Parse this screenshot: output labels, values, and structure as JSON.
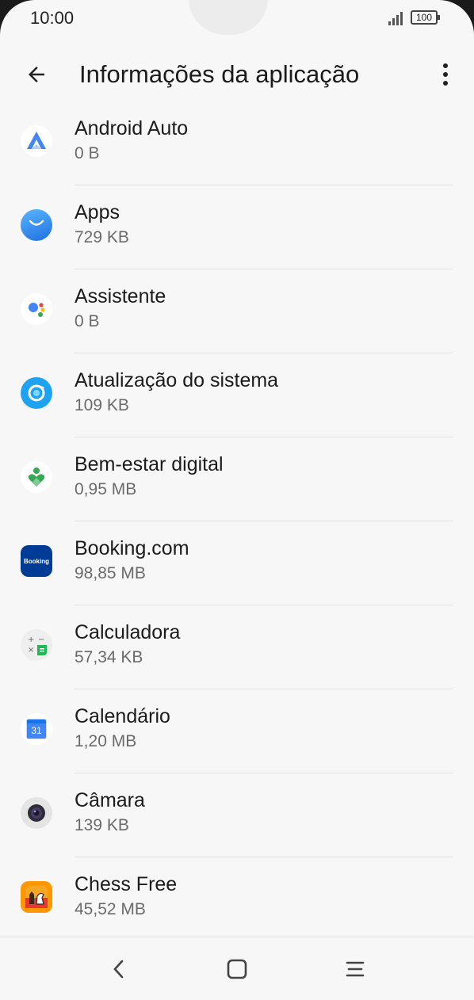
{
  "status_bar": {
    "time": "10:00",
    "battery": "100"
  },
  "app_bar": {
    "title": "Informações da aplicação"
  },
  "apps": [
    {
      "name": "Android Auto",
      "size": "0 B",
      "icon": "android-auto-icon"
    },
    {
      "name": "Apps",
      "size": "729 KB",
      "icon": "apps-store-icon"
    },
    {
      "name": "Assistente",
      "size": "0 B",
      "icon": "assistant-icon"
    },
    {
      "name": "Atualização do sistema",
      "size": "109 KB",
      "icon": "system-update-icon"
    },
    {
      "name": "Bem-estar digital",
      "size": "0,95 MB",
      "icon": "digital-wellbeing-icon"
    },
    {
      "name": "Booking.com",
      "size": "98,85 MB",
      "icon": "booking-icon",
      "icon_text": "Booking"
    },
    {
      "name": "Calculadora",
      "size": "57,34 KB",
      "icon": "calculator-icon"
    },
    {
      "name": "Calendário",
      "size": "1,20 MB",
      "icon": "calendar-icon",
      "icon_text": "31"
    },
    {
      "name": "Câmara",
      "size": "139 KB",
      "icon": "camera-icon"
    },
    {
      "name": "Chess Free",
      "size": "45,52 MB",
      "icon": "chess-icon"
    }
  ],
  "colors": {
    "background": "#f7f7f7",
    "text_primary": "#1c1c1c",
    "text_secondary": "#6b6b6b",
    "booking_blue": "#003b95",
    "assistant_blue": "#4285f4"
  }
}
